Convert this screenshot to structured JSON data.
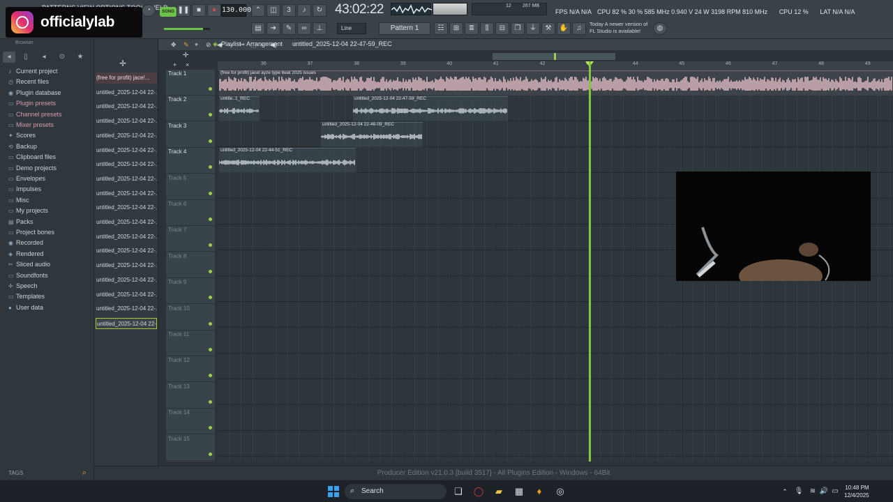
{
  "menu": "PATTERNS VIEW OPTIONS TOOLS HELP",
  "transport": {
    "song_mode": "SONG",
    "tempo": "130.000",
    "time": "43:02:22"
  },
  "stats": {
    "fps": "FPS N/A N/A",
    "cpu_left": "CPU 82 % 30 % 585 MHz 0.940 V 24 W 3198 RPM 810 MHz",
    "cpu": "CPU 12 %",
    "lat": "LAT N/A N/A",
    "mem": "267 MB",
    "voices": "12"
  },
  "overlay": {
    "handle": "officialylab"
  },
  "toolbar": {
    "snap": "Line",
    "pattern": "Pattern 1",
    "news": "Today  A newer version of FL Studio is available!"
  },
  "browser": {
    "header": "Browser",
    "items": [
      {
        "label": "Current project",
        "icon": "project-icon",
        "pink": false
      },
      {
        "label": "Recent files",
        "icon": "recent-icon",
        "pink": false
      },
      {
        "label": "Plugin database",
        "icon": "database-icon",
        "pink": false
      },
      {
        "label": "Plugin presets",
        "icon": "folder-icon",
        "pink": true
      },
      {
        "label": "Channel presets",
        "icon": "folder-icon",
        "pink": true
      },
      {
        "label": "Mixer presets",
        "icon": "folder-icon",
        "pink": true
      },
      {
        "label": "Scores",
        "icon": "scores-icon",
        "pink": false
      },
      {
        "label": "Backup",
        "icon": "backup-icon",
        "pink": false
      },
      {
        "label": "Clipboard files",
        "icon": "folder-icon",
        "pink": false
      },
      {
        "label": "Demo projects",
        "icon": "folder-icon",
        "pink": false
      },
      {
        "label": "Envelopes",
        "icon": "folder-icon",
        "pink": false
      },
      {
        "label": "Impulses",
        "icon": "folder-icon",
        "pink": false
      },
      {
        "label": "Misc",
        "icon": "folder-icon",
        "pink": false
      },
      {
        "label": "My projects",
        "icon": "folder-icon",
        "pink": false
      },
      {
        "label": "Packs",
        "icon": "packs-icon",
        "pink": false
      },
      {
        "label": "Project bones",
        "icon": "folder-icon",
        "pink": false
      },
      {
        "label": "Recorded",
        "icon": "recorded-icon",
        "pink": false
      },
      {
        "label": "Rendered",
        "icon": "rendered-icon",
        "pink": false
      },
      {
        "label": "Sliced audio",
        "icon": "sliced-icon",
        "pink": false
      },
      {
        "label": "Soundfonts",
        "icon": "folder-icon",
        "pink": false
      },
      {
        "label": "Speech",
        "icon": "speech-icon",
        "pink": false
      },
      {
        "label": "Templates",
        "icon": "folder-icon",
        "pink": false
      },
      {
        "label": "User data",
        "icon": "user-icon",
        "pink": false
      }
    ],
    "tags": "TAGS"
  },
  "picker": {
    "items": [
      "(free for profit) jace!...",
      "untitled_2025-12-04 22-...",
      "untitled_2025-12-04 22-...",
      "untitled_2025-12-04 22-...",
      "untitled_2025-12-04 22-...",
      "untitled_2025-12-04 22-...",
      "untitled_2025-12-04 22-...",
      "untitled_2025-12-04 22-...",
      "untitled_2025-12-04 22-...",
      "untitled_2025-12-04 22-...",
      "untitled_2025-12-04 22-...",
      "untitled_2025-12-04 22-...",
      "untitled_2025-12-04 22-...",
      "untitled_2025-12-04 22-...",
      "untitled_2025-12-04 22-...",
      "untitled_2025-12-04 22-...",
      "untitled_2025-12-04 22-...",
      "untitled_2025-12-04 22-..."
    ]
  },
  "playlist": {
    "title": "Playlist - Arrangement",
    "pattern": "untitled_2025-12-04 22-47-59_REC",
    "ruler": [
      "36",
      "37",
      "38",
      "39",
      "40",
      "41",
      "42",
      "43",
      "44",
      "45",
      "46",
      "47",
      "48",
      "49"
    ],
    "tracks": [
      "Track 1",
      "Track 2",
      "Track 3",
      "Track 4",
      "Track 5",
      "Track 6",
      "Track 7",
      "Track 8",
      "Track 9",
      "Track 10",
      "Track 11",
      "Track 12",
      "Track 13",
      "Track 14",
      "Track 15"
    ],
    "clips": [
      {
        "label": "(free for profit) jacel  ayze type beat 2025 issues"
      },
      {
        "label": "untitle..1_REC"
      },
      {
        "label": "untitled_2025-12-04 22-47-59_REC"
      },
      {
        "label": "untitled_2025-12-04 22-46-09_REC"
      },
      {
        "label": "untitled_2025-12-04 22-44-51_REC"
      }
    ]
  },
  "status": "Producer Edition v21.0.3 [build 3517] - All Plugins Edition - Windows - 64Bit",
  "taskbar": {
    "search": "Search",
    "time": "10:48 PM",
    "date": "12/4/2025"
  },
  "colors": {
    "accent": "#83c63b",
    "clip_audio": "#d9b4bf"
  }
}
